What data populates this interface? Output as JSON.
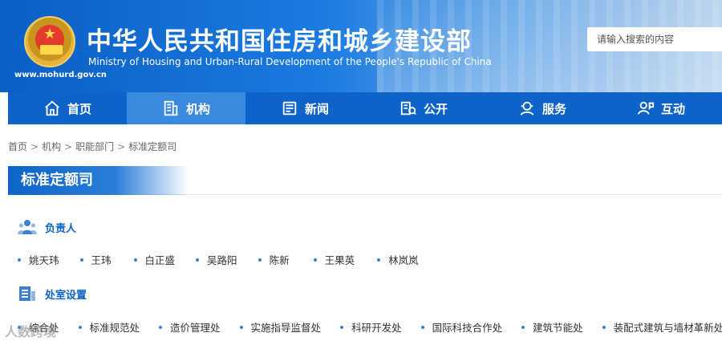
{
  "header": {
    "title_cn": "中华人民共和国住房和城乡建设部",
    "title_en": "Ministry of Housing and Urban-Rural Development of the People's Republic of China",
    "site_url": "www.mohurd.gov.cn",
    "search_placeholder": "请输入搜索的内容"
  },
  "nav": {
    "items": [
      {
        "label": "首页",
        "icon": "home-icon"
      },
      {
        "label": "机构",
        "icon": "building-icon",
        "active": true
      },
      {
        "label": "新闻",
        "icon": "news-icon"
      },
      {
        "label": "公开",
        "icon": "public-info-icon"
      },
      {
        "label": "服务",
        "icon": "service-icon"
      },
      {
        "label": "互动",
        "icon": "interaction-icon"
      }
    ]
  },
  "breadcrumb": {
    "items": [
      "首页",
      "机构",
      "职能部门",
      "标准定额司"
    ],
    "separator": ">"
  },
  "page_title": "标准定额司",
  "leaders": {
    "heading": "负责人",
    "names": [
      "姚天玮",
      "王玮",
      "白正盛",
      "吴路阳",
      "陈新",
      "王果英",
      "林岚岚"
    ]
  },
  "divisions": {
    "heading": "处室设置",
    "names": [
      "综合处",
      "标准规范处",
      "造价管理处",
      "实施指导监督处",
      "科研开发处",
      "国际科技合作处",
      "建筑节能处",
      "装配式建筑与墙材革新处"
    ]
  },
  "watermark": "人数跨境",
  "colors": {
    "brand_blue": "#0d63c7",
    "nav_active": "#3a8ae0"
  }
}
